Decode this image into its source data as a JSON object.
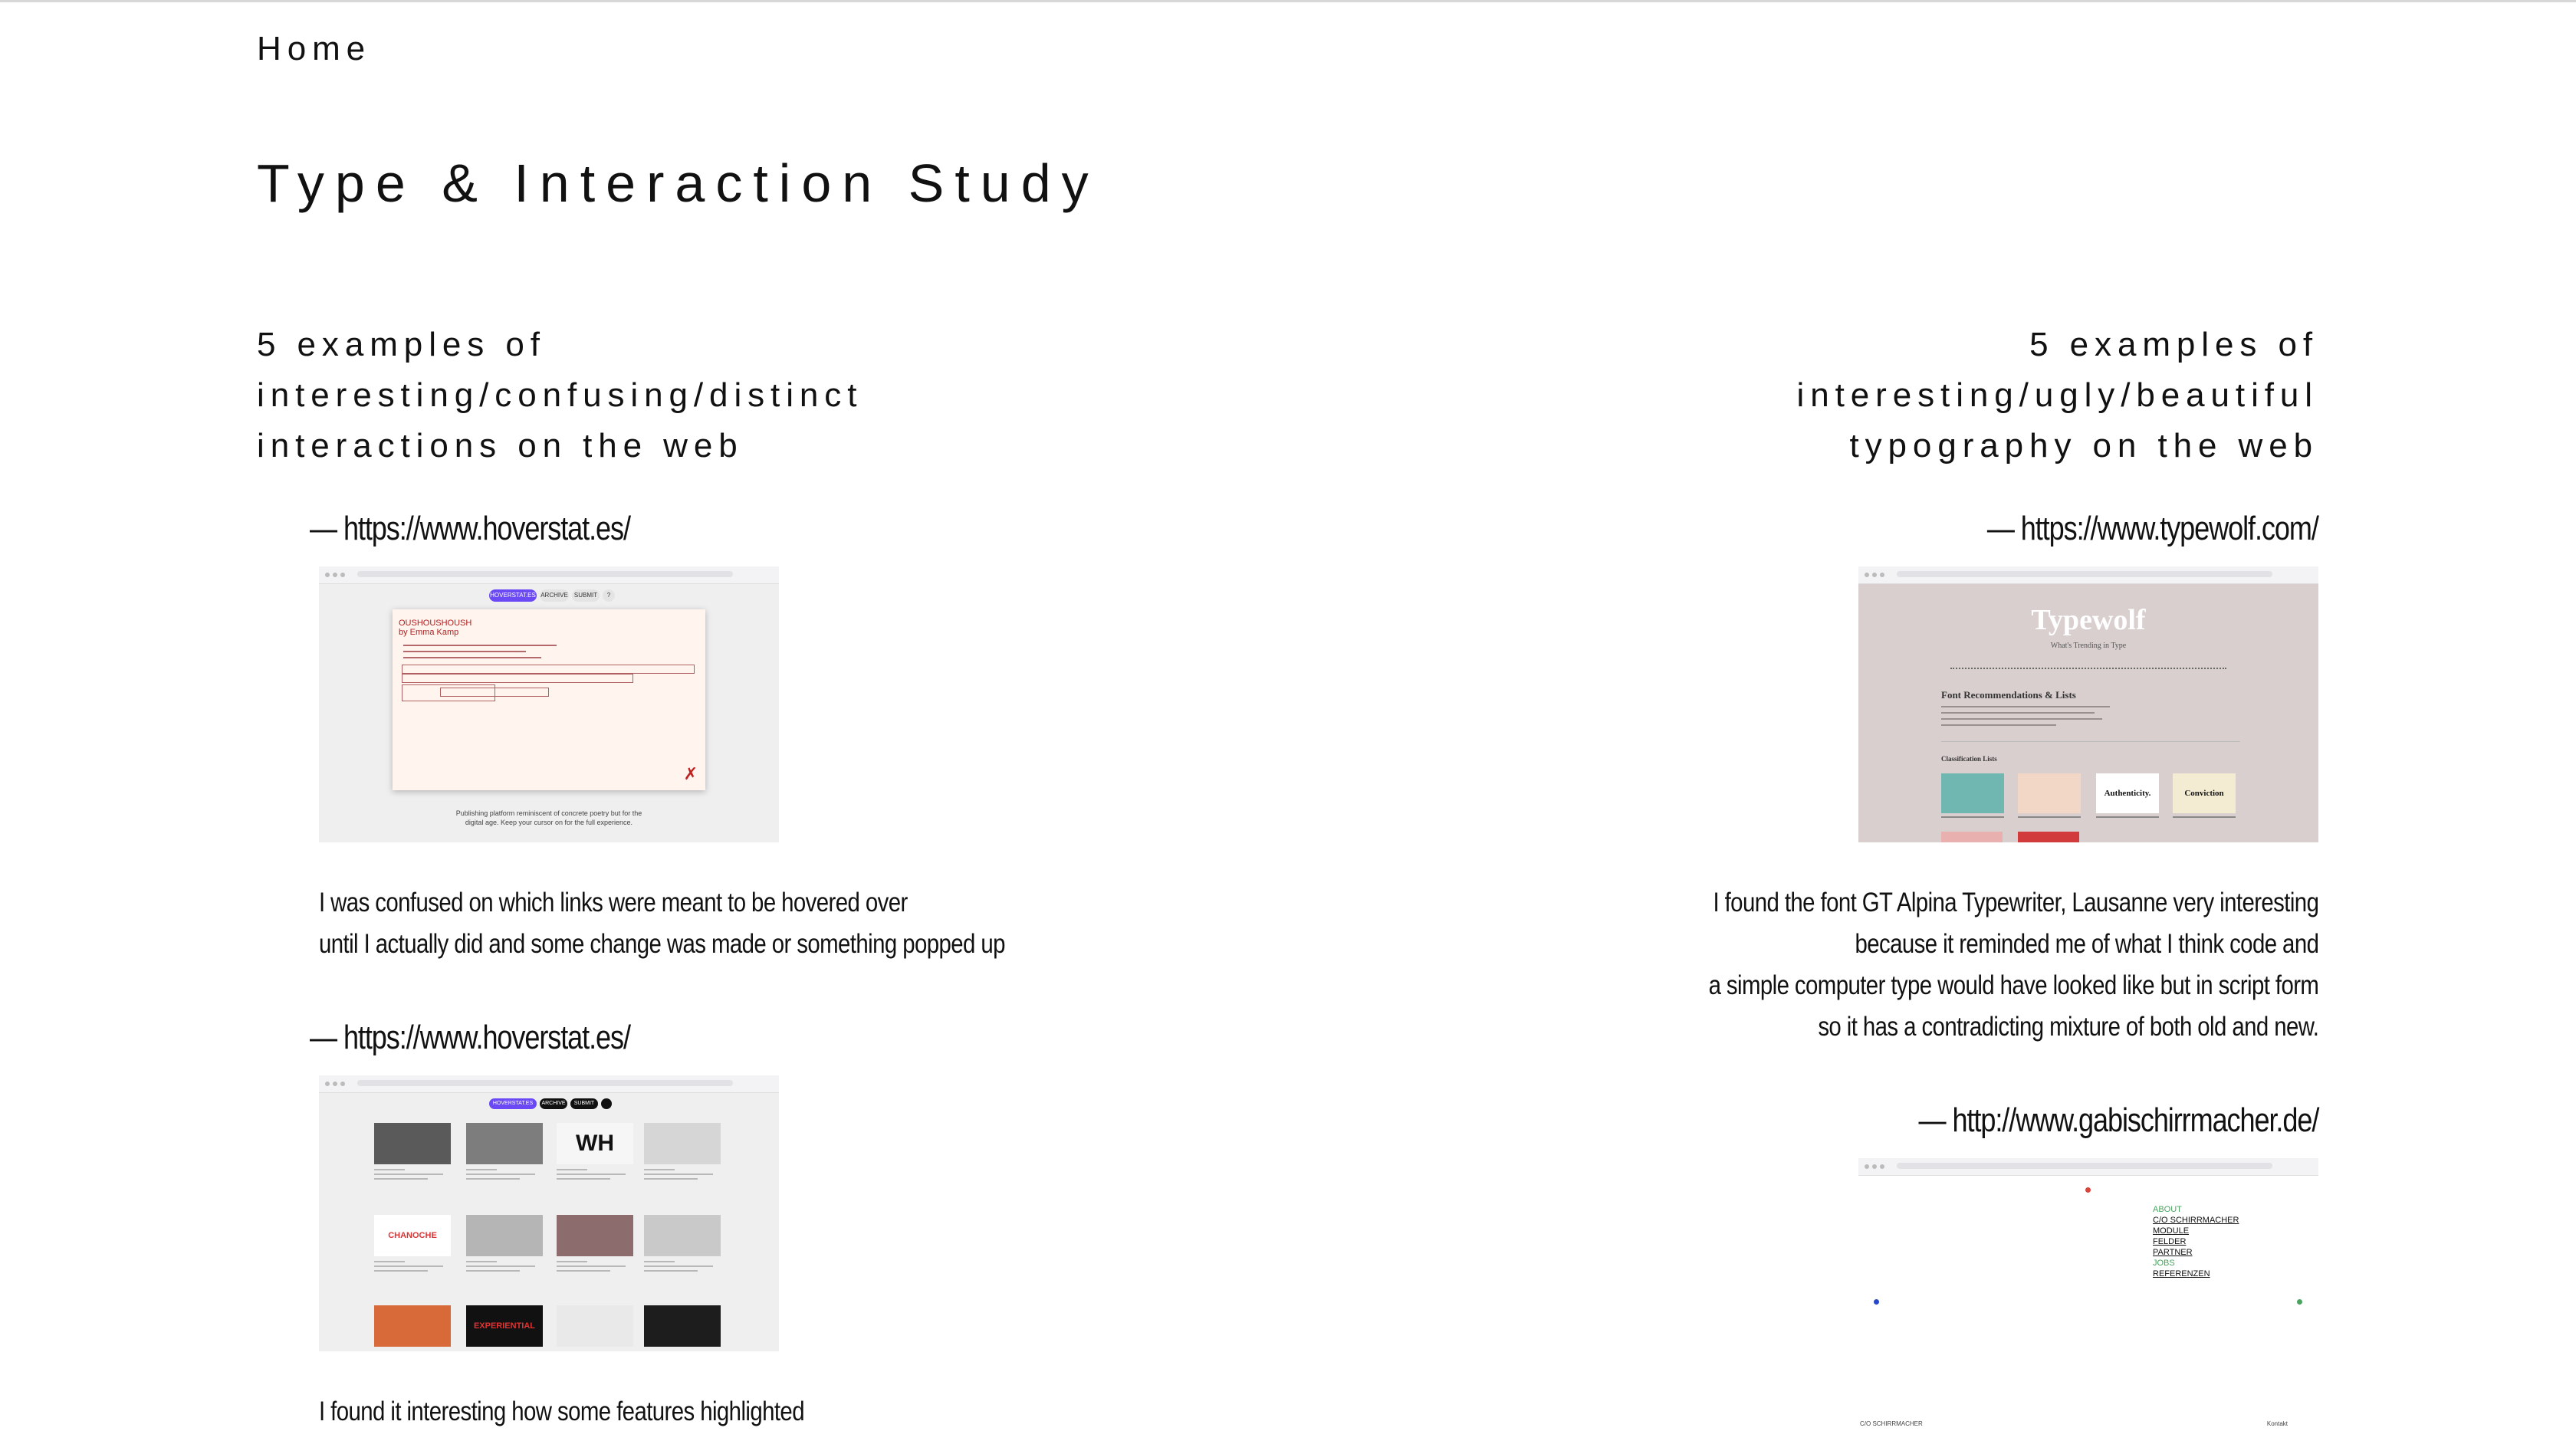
{
  "nav": {
    "home_label": "Home"
  },
  "page": {
    "title": "Type & Interaction Study"
  },
  "left_column": {
    "heading_lines": [
      "5 examples of",
      "interesting/confusing/distinct",
      "interactions on the web"
    ],
    "entries": [
      {
        "link": "— https://www.hoverstat.es/",
        "description_lines": [
          "I was confused on which links were meant to be hovered over",
          "until I actually did and some change was made or something popped up"
        ]
      },
      {
        "link": "— https://www.hoverstat.es/",
        "description_lines": [
          "I found it interesting how some features highlighted"
        ]
      }
    ]
  },
  "right_column": {
    "heading_lines": [
      "5 examples of",
      "interesting/ugly/beautiful",
      "typography on the web"
    ],
    "entries": [
      {
        "link": "— https://www.typewolf.com/",
        "description_lines": [
          "I found the font GT Alpina Typewriter, Lausanne very interesting",
          "because it reminded me of what I think code and",
          "a simple computer type would have looked like but in script form",
          "so it has a contradicting mixture of both old and new."
        ]
      },
      {
        "link": "— http://www.gabischirrmacher.de/",
        "description_lines": []
      }
    ]
  },
  "screenshots": {
    "hoverstat_1": {
      "pills": [
        "HOVERSTAT.ES",
        "ARCHIVE",
        "SUBMIT",
        "?"
      ],
      "card_heading": "OUSHOUSHOUSH\nby Emma Kamp",
      "caption_lines": [
        "Publishing platform reminiscent of concrete poetry but for the",
        "digital age. Keep your cursor on for the full experience."
      ]
    },
    "hoverstat_2": {
      "tabs": [
        "HOVERSTAT.ES",
        "ARCHIVE",
        "SUBMIT"
      ],
      "tile_texts": [
        "",
        "",
        "WH",
        "",
        "CHANOCHE",
        "",
        "",
        "",
        "",
        "EXPERIENTIAL",
        "",
        ""
      ],
      "tile_colors": [
        "#5a5a5a",
        "#7d7d7d",
        "#f6f6f6",
        "#d6d6d6",
        "#ffffff",
        "#b5b5b5",
        "#8c6c6c",
        "#c9c9c9",
        "#d86a3a",
        "#111111",
        "#e9e9e9",
        "#1d1d1d"
      ]
    },
    "typewolf": {
      "brand": "Typewolf",
      "tagline": "What's Trending in Type",
      "section_heading": "Font Recommendations & Lists",
      "classification": "Classification Lists",
      "cards": [
        {
          "text": "",
          "color": "#6fb7b0"
        },
        {
          "text": "",
          "color": "#f2d6c6"
        },
        {
          "text": "Authenticity.",
          "color": "#ffffff"
        },
        {
          "text": "Conviction",
          "color": "#f3ecd2"
        }
      ],
      "strip_colors": [
        "#e9b0b0",
        "#d23b3b"
      ]
    },
    "gabischirrmacher": {
      "menu_items": [
        "ABOUT",
        "C/O SCHIRRMACHER",
        "MODULE",
        "FELDER",
        "PARTNER",
        "JOBS",
        "REFERENZEN"
      ],
      "accent_items": [
        0,
        5
      ],
      "footer_left": "C/O SCHIRRMACHER",
      "footer_right": "Kontakt"
    }
  },
  "colors": {
    "accent_purple": "#6b49f5",
    "gabi_green": "#4aa35f",
    "gabi_red": "#d9453b",
    "gabi_blue": "#2947c9"
  }
}
